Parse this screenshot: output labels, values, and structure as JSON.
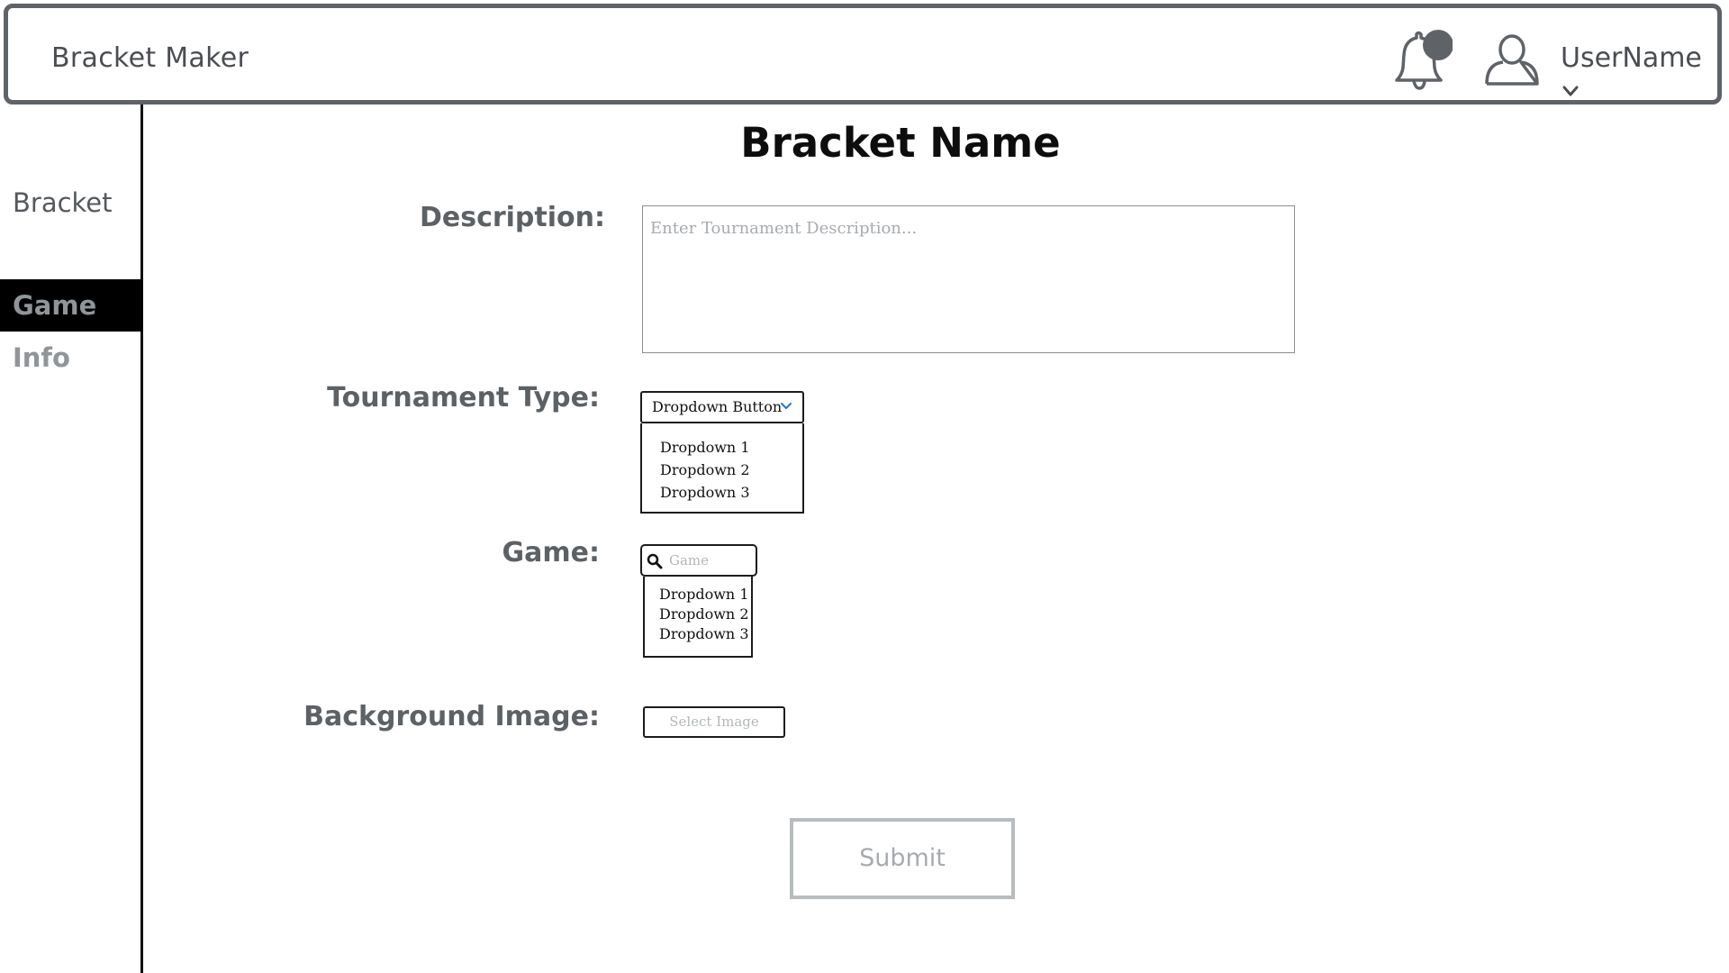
{
  "header": {
    "app_title": "Bracket Maker",
    "username": "UserName"
  },
  "sidebar": {
    "items": [
      {
        "label": "Bracket",
        "active": false
      },
      {
        "label": "Game Info",
        "active": true
      }
    ]
  },
  "main": {
    "title": "Bracket Name",
    "description": {
      "label": "Description:",
      "placeholder": "Enter Tournament Description..."
    },
    "tournament_type": {
      "label": "Tournament Type:",
      "button_label": "Dropdown Button",
      "options": [
        "Dropdown 1",
        "Dropdown 2",
        "Dropdown 3"
      ]
    },
    "game": {
      "label": "Game:",
      "placeholder": "Game",
      "options": [
        "Dropdown 1",
        "Dropdown 2",
        "Dropdown 3"
      ]
    },
    "background_image": {
      "label": "Background Image:",
      "button_label": "Select Image"
    },
    "submit_label": "Submit"
  },
  "colors": {
    "border_dark": "#5f6368",
    "sidebar_active_bg": "#000000",
    "accent_chevron": "#1f77d0",
    "muted_text": "#a7abaf"
  },
  "icons": [
    "bell-icon",
    "user-icon",
    "chevron-down-icon",
    "search-icon"
  ]
}
